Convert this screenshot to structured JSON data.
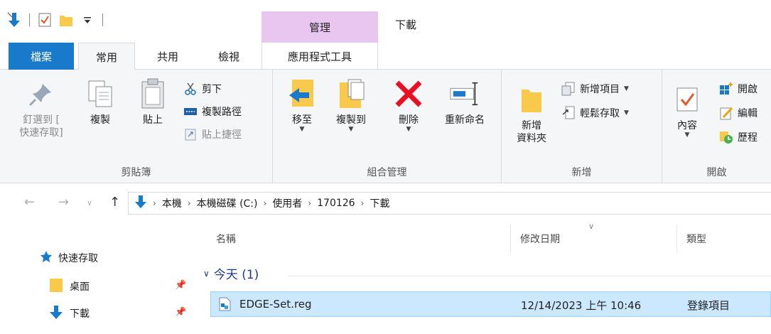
{
  "window": {
    "title": "下載",
    "context_group": "管理"
  },
  "tabs": {
    "file": "檔案",
    "home": "常用",
    "share": "共用",
    "view": "檢視",
    "tools": "應用程式工具"
  },
  "ribbon": {
    "clipboard": {
      "label": "剪貼簿",
      "pin": "釘選到 [\n快速存取]",
      "copy": "複製",
      "paste": "貼上",
      "cut": "剪下",
      "copy_path": "複製路徑",
      "paste_shortcut": "貼上捷徑"
    },
    "organize": {
      "label": "組合管理",
      "move_to": "移至",
      "copy_to": "複製到",
      "delete": "刪除",
      "rename": "重新命名"
    },
    "new": {
      "label": "新增",
      "new_folder": "新增\n資料夾",
      "new_item": "新增項目",
      "easy_access": "輕鬆存取"
    },
    "open": {
      "label": "開啟",
      "properties": "內容",
      "open": "開啟",
      "edit": "編輯",
      "history": "歷程"
    }
  },
  "address": {
    "breadcrumbs": [
      "本機",
      "本機磁碟 (C:)",
      "使用者",
      "170126",
      "下載"
    ]
  },
  "navpane": {
    "items": [
      {
        "label": "快速存取"
      },
      {
        "label": "桌面"
      },
      {
        "label": "下載"
      }
    ]
  },
  "filelist": {
    "columns": {
      "name": "名稱",
      "modified": "修改日期",
      "type": "類型"
    },
    "group": "今天 (1)",
    "rows": [
      {
        "name": "EDGE-Set.reg",
        "modified": "12/14/2023 上午 10:46",
        "type": "登錄項目"
      }
    ]
  },
  "colors": {
    "accent": "#1979ca",
    "context": "#e9c6f0",
    "selection": "#cce8ff",
    "delete_red": "#e81123",
    "folder": "#f8c94a"
  }
}
